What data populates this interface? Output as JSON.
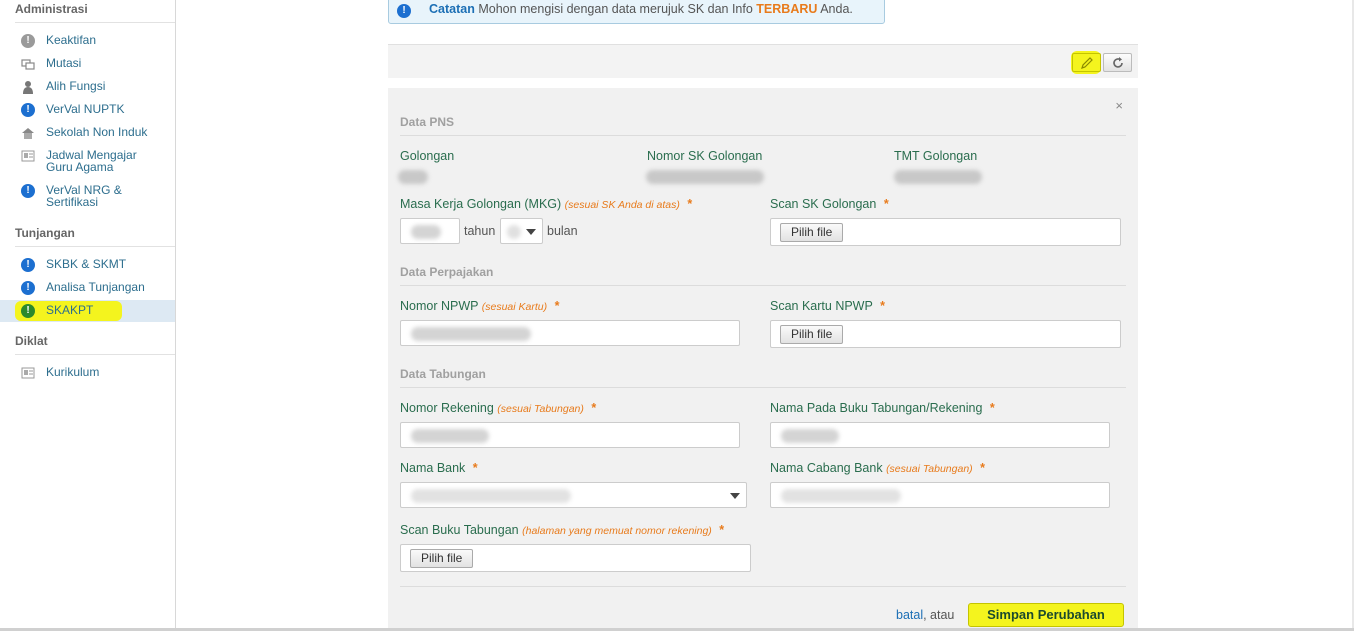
{
  "sidebar": {
    "sections": [
      {
        "title": "Administrasi",
        "items": [
          {
            "label": "Keaktifan",
            "icon": "grey-alert-icon"
          },
          {
            "label": "Mutasi",
            "icon": "transfer-icon"
          },
          {
            "label": "Alih Fungsi",
            "icon": "user-icon"
          },
          {
            "label": "VerVal NUPTK",
            "icon": "info-alert-icon"
          },
          {
            "label": "Sekolah Non Induk",
            "icon": "school-icon"
          },
          {
            "label": "Jadwal Mengajar Guru Agama",
            "icon": "card-icon"
          },
          {
            "label": "VerVal NRG & Sertifikasi",
            "icon": "info-alert-icon"
          }
        ]
      },
      {
        "title": "Tunjangan",
        "items": [
          {
            "label": "SKBK & SKMT",
            "icon": "info-alert-icon"
          },
          {
            "label": "Analisa Tunjangan",
            "icon": "info-alert-icon"
          },
          {
            "label": "SKAKPT",
            "icon": "green-alert-icon",
            "active": true
          }
        ]
      },
      {
        "title": "Diklat",
        "items": [
          {
            "label": "Kurikulum",
            "icon": "card-icon"
          }
        ]
      }
    ]
  },
  "notice": {
    "label": "Catatan",
    "text_before": "Mohon mengisi dengan data merujuk SK dan Info",
    "highlight": "TERBARU",
    "text_after": "Anda."
  },
  "form": {
    "close": "×",
    "pns": {
      "title": "Data PNS",
      "golongan_label": "Golongan",
      "nomor_sk_label": "Nomor SK Golongan",
      "tmt_label": "TMT Golongan",
      "mkg_label": "Masa Kerja Golongan (MKG)",
      "mkg_hint": "(sesuai SK Anda di atas)",
      "tahun": "tahun",
      "bulan": "bulan",
      "scan_sk_label": "Scan SK Golongan"
    },
    "pajak": {
      "title": "Data Perpajakan",
      "npwp_label": "Nomor NPWP",
      "npwp_hint": "(sesuai Kartu)",
      "scan_npwp_label": "Scan Kartu NPWP"
    },
    "tabungan": {
      "title": "Data Tabungan",
      "rekening_label": "Nomor Rekening",
      "rekening_hint": "(sesuai Tabungan)",
      "nama_buku_label": "Nama Pada Buku Tabungan/Rekening",
      "bank_label": "Nama Bank",
      "cabang_label": "Nama Cabang Bank",
      "cabang_hint": "(sesuai Tabungan)",
      "scan_buku_label": "Scan Buku Tabungan",
      "scan_buku_hint": "(halaman yang memuat nomor rekening)"
    },
    "required_mark": "*",
    "file_button": "Pilih file",
    "cancel_link": "batal",
    "cancel_suffix": ", atau",
    "save_button": "Simpan Perubahan"
  },
  "colors": {
    "accent_highlight": "#f4f41e",
    "link": "#1c6fb5",
    "label_green": "#2a6d4e",
    "required_orange": "#e87b1c"
  }
}
